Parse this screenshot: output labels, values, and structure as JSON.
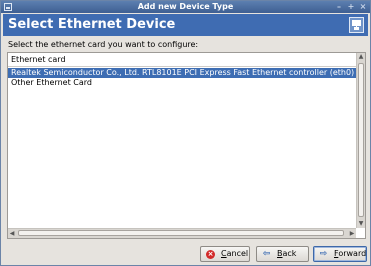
{
  "window": {
    "title": "Add new Device Type"
  },
  "banner": {
    "heading": "Select Ethernet Device"
  },
  "prompt": "Select the ethernet card you want to configure:",
  "list": {
    "column_header": "Ethernet card",
    "items": [
      {
        "label": "Realtek Semiconductor Co., Ltd. RTL8101E PCI Express Fast Ethernet controller (eth0)",
        "selected": true
      },
      {
        "label": "Other Ethernet Card",
        "selected": false
      }
    ]
  },
  "buttons": {
    "cancel": {
      "mnemonic": "C",
      "rest": "ancel"
    },
    "back": {
      "mnemonic": "B",
      "rest": "ack"
    },
    "forward": {
      "mnemonic": "F",
      "rest": "orward"
    }
  },
  "colors": {
    "banner": "#3f6cb2",
    "selection": "#3d6db3",
    "titlebar": "#4a6da0"
  },
  "icons": [
    "app-icon",
    "minimize-icon",
    "maximize-icon",
    "close-icon",
    "network-device-icon",
    "cancel-icon",
    "back-arrow-icon",
    "forward-arrow-icon"
  ]
}
